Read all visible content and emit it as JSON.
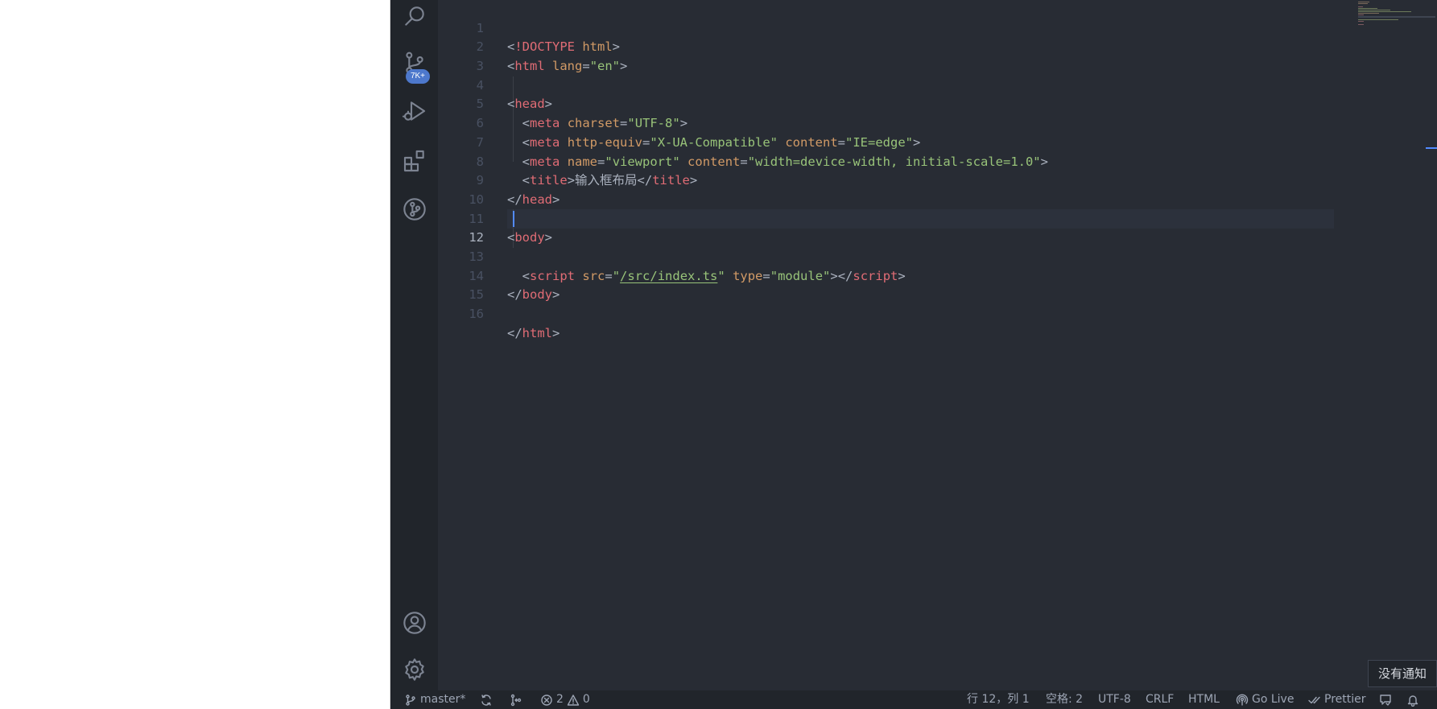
{
  "activity_bar": {
    "scm_badge": "7K+",
    "icons": [
      "search-icon",
      "source-control-icon",
      "run-debug-icon",
      "extensions-icon",
      "git-graph-icon",
      "account-icon",
      "settings-gear-icon"
    ]
  },
  "editor": {
    "active_line": 12,
    "lines": [
      {
        "number": "1"
      },
      {
        "number": "2"
      },
      {
        "number": "3"
      },
      {
        "number": "4"
      },
      {
        "number": "5"
      },
      {
        "number": "6"
      },
      {
        "number": "7"
      },
      {
        "number": "8"
      },
      {
        "number": "9"
      },
      {
        "number": "10"
      },
      {
        "number": "11"
      },
      {
        "number": "12"
      },
      {
        "number": "13"
      },
      {
        "number": "14"
      },
      {
        "number": "15"
      },
      {
        "number": "16"
      }
    ],
    "code": {
      "l1_doctype": "!DOCTYPE",
      "l1_html": "html",
      "l2_tag": "html",
      "l2_attr": "lang",
      "l2_val": "\"en\"",
      "l4_tag": "head",
      "l5_tag": "meta",
      "l5_attr": "charset",
      "l5_val": "\"UTF-8\"",
      "l6_tag": "meta",
      "l6_attr1": "http-equiv",
      "l6_val1": "\"X-UA-Compatible\"",
      "l6_attr2": "content",
      "l6_val2": "\"IE=edge\"",
      "l7_tag": "meta",
      "l7_attr1": "name",
      "l7_val1": "\"viewport\"",
      "l7_attr2": "content",
      "l7_val2": "\"width=device-width, initial-scale=1.0\"",
      "l8_tag": "title",
      "l8_text": "输入框布局",
      "l9_tag": "head",
      "l11_tag": "body",
      "l13_tag": "script",
      "l13_attr1": "src",
      "l13_q": "\"",
      "l13_path": "/src/index.ts",
      "l13_attr2": "type",
      "l13_val2": "\"module\"",
      "l14_tag": "body",
      "l16_tag": "html"
    }
  },
  "notification": {
    "text": "没有通知"
  },
  "status_bar": {
    "branch": "master*",
    "errors": "2",
    "warnings": "0",
    "cursor_position": "行 12，列 1",
    "indentation": "空格: 2",
    "encoding": "UTF-8",
    "line_ending": "CRLF",
    "language": "HTML",
    "go_live": "Go Live",
    "prettier": "Prettier"
  },
  "colors": {
    "editor_bg": "#282c34",
    "sidebar_bg": "#21252b",
    "tag": "#e06c75",
    "attribute": "#d19a66",
    "string": "#98c379",
    "text": "#abb2bf",
    "accent": "#4d78cc"
  }
}
